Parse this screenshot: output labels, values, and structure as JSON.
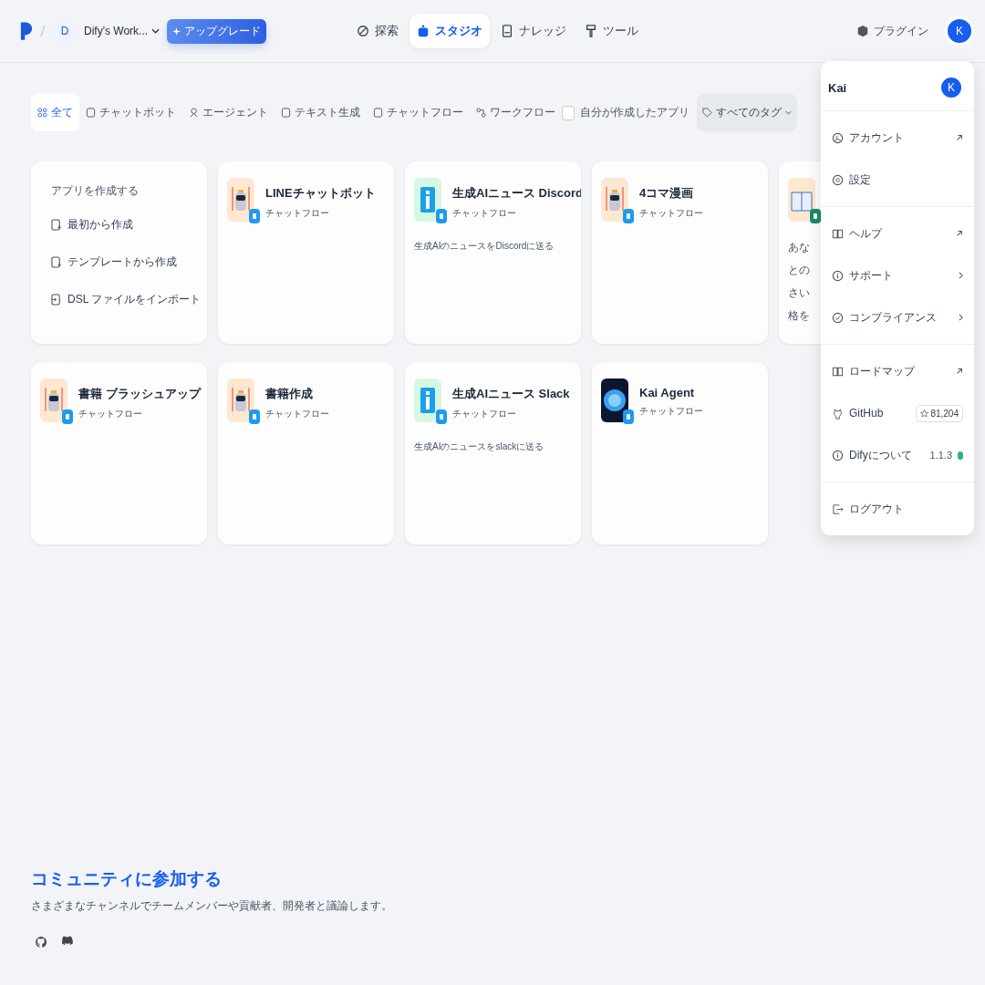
{
  "header": {
    "workspace": {
      "initial": "D",
      "name": "Dify's Work..."
    },
    "upgrade": "アップグレード",
    "nav": [
      {
        "label": "探索",
        "selected": false
      },
      {
        "label": "スタジオ",
        "selected": true
      },
      {
        "label": "ナレッジ",
        "selected": false
      },
      {
        "label": "ツール",
        "selected": false
      }
    ],
    "plugins": "プラグイン",
    "avatar": "K"
  },
  "filters": {
    "tabs": [
      {
        "label": "全て",
        "selected": true
      },
      {
        "label": "チャットボット",
        "selected": false
      },
      {
        "label": "エージェント",
        "selected": false
      },
      {
        "label": "テキスト生成",
        "selected": false
      },
      {
        "label": "チャットフロー",
        "selected": false
      },
      {
        "label": "ワークフロー",
        "selected": false
      }
    ],
    "mine": {
      "label": "自分が作成したアプリ",
      "checked": false
    },
    "tags": "すべてのタグ"
  },
  "create": {
    "title": "アプリを作成する",
    "items": [
      "最初から作成",
      "テンプレートから作成",
      "DSL ファイルをインポート"
    ]
  },
  "apps": [
    {
      "name": "LINEチャットボット",
      "type": "チャットフロー",
      "kind": "robot",
      "color": "#1e9af0"
    },
    {
      "name": "生成AIニュース Discord",
      "type": "チャットフロー",
      "kind": "info",
      "color": "#1e9af0",
      "description": "生成AIのニュースをDiscordに送る"
    },
    {
      "name": "4コマ漫画",
      "type": "チャットフロー",
      "kind": "robot",
      "color": "#1e9af0"
    },
    {
      "kind": "book",
      "color": "#1a8a6b",
      "description_lines": [
        "あな",
        "との",
        "さい",
        "格を"
      ]
    },
    {
      "name": "書籍 ブラッシュアップ",
      "type": "チャットフロー",
      "kind": "robot",
      "color": "#1e9af0"
    },
    {
      "name": "書籍作成",
      "type": "チャットフロー",
      "kind": "robot",
      "color": "#1e9af0"
    },
    {
      "name": "生成AIニュース Slack",
      "type": "チャットフロー",
      "kind": "info",
      "color": "#1e9af0",
      "description": "生成AIのニュースをslackに送る"
    },
    {
      "name": "Kai Agent",
      "type": "チャットフロー",
      "kind": "orb",
      "color": "#1e9af0"
    }
  ],
  "community": {
    "title": "コミュニティに参加する",
    "text": "さまざまなチャンネルでチームメンバーや貢献者、開発者と議論します。"
  },
  "menu": {
    "user": "Kai",
    "avatar": "K",
    "sections": [
      [
        {
          "label": "アカウント",
          "kind": "link"
        },
        {
          "label": "設定",
          "kind": "plain"
        }
      ],
      [
        {
          "label": "ヘルプ",
          "kind": "link"
        },
        {
          "label": "サポート",
          "kind": "submenu"
        },
        {
          "label": "コンプライアンス",
          "kind": "submenu"
        }
      ],
      [
        {
          "label": "ロードマップ",
          "kind": "link"
        },
        {
          "label": "GitHub",
          "kind": "stars",
          "value": "81,204"
        },
        {
          "label": "Difyについて",
          "kind": "version",
          "value": "1.1.3",
          "color": "#2fb574"
        }
      ],
      [
        {
          "label": "ログアウト",
          "kind": "plain"
        }
      ]
    ]
  }
}
